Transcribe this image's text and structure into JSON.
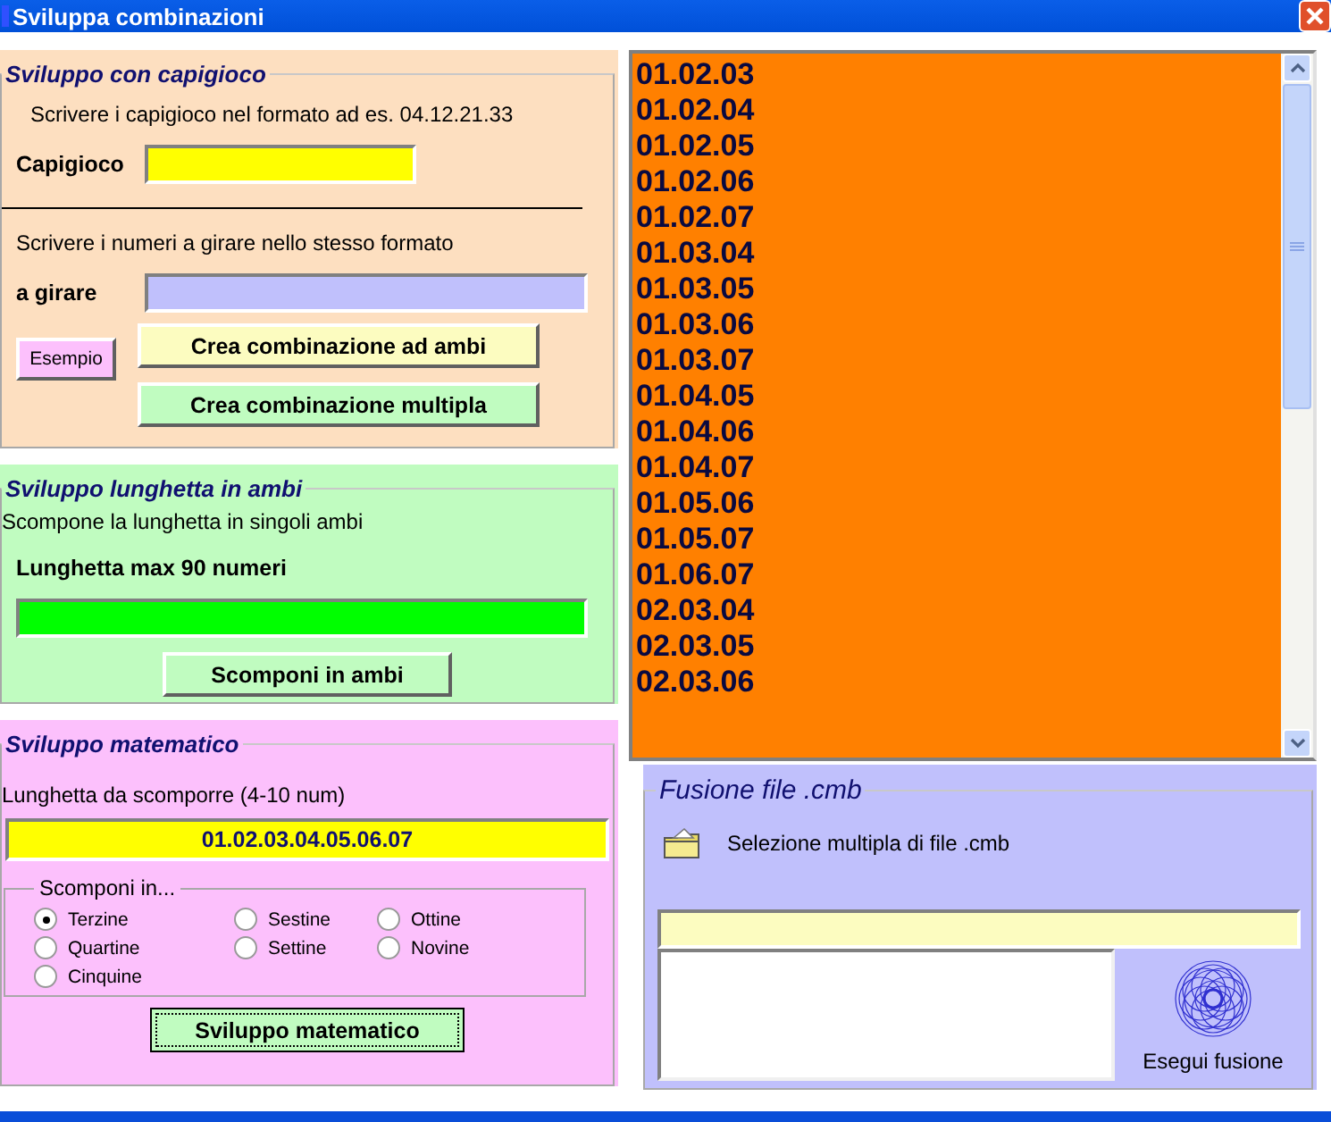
{
  "window": {
    "title": "Sviluppa combinazioni"
  },
  "capigioco": {
    "legend": "Sviluppo con capigioco",
    "hint": "Scrivere i capigioco nel formato ad es. 04.12.21.33",
    "field_label": "Capigioco",
    "hint2": "Scrivere i numeri a girare nello stesso formato",
    "field2_label": "a girare",
    "example_button": "Esempio",
    "buttons": [
      "Crea combinazione ad ambi",
      "Crea combinazione multipla"
    ]
  },
  "lunghetta": {
    "legend": "Sviluppo lunghetta in ambi",
    "hint": "Scompone la lunghetta in singoli ambi",
    "field_label": "Lunghetta max 90 numeri",
    "button": "Scomponi in ambi"
  },
  "matematico": {
    "legend": "Sviluppo matematico",
    "hint": "Lunghetta da scomporre (4-10 num)",
    "value": "01.02.03.04.05.06.07",
    "group_legend": "Scomponi in...",
    "option_columns": [
      [
        {
          "label": "Terzine",
          "selected": true
        },
        {
          "label": "Quartine",
          "selected": false
        },
        {
          "label": "Cinquine",
          "selected": false
        }
      ],
      [
        {
          "label": "Sestine",
          "selected": false
        },
        {
          "label": "Settine",
          "selected": false
        }
      ],
      [
        {
          "label": "Ottine",
          "selected": false
        },
        {
          "label": "Novine",
          "selected": false
        }
      ]
    ],
    "button": "Sviluppo matematico"
  },
  "results": [
    "01.02.03",
    "01.02.04",
    "01.02.05",
    "01.02.06",
    "01.02.07",
    "01.03.04",
    "01.03.05",
    "01.03.06",
    "01.03.07",
    "01.04.05",
    "01.04.06",
    "01.04.07",
    "01.05.06",
    "01.05.07",
    "01.06.07",
    "02.03.04",
    "02.03.05",
    "02.03.06"
  ],
  "fusione": {
    "legend": "Fusione file .cmb",
    "select_label": "Selezione multipla di file .cmb",
    "run_button": "Esegui fusione"
  }
}
